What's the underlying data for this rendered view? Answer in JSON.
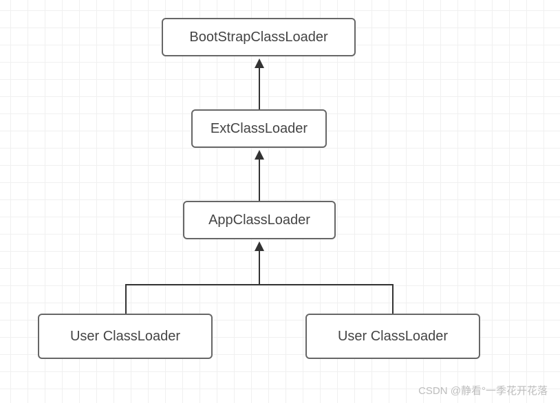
{
  "chart_data": {
    "type": "tree",
    "direction": "bottom-up",
    "nodes": [
      {
        "id": "bootstrap",
        "label": "BootStrapClassLoader"
      },
      {
        "id": "ext",
        "label": "ExtClassLoader"
      },
      {
        "id": "app",
        "label": "AppClassLoader"
      },
      {
        "id": "user1",
        "label": "User ClassLoader"
      },
      {
        "id": "user2",
        "label": "User ClassLoader"
      }
    ],
    "edges": [
      {
        "from": "ext",
        "to": "bootstrap"
      },
      {
        "from": "app",
        "to": "ext"
      },
      {
        "from": "user1",
        "to": "app"
      },
      {
        "from": "user2",
        "to": "app"
      }
    ]
  },
  "watermark": "CSDN @静看°一季花开花落"
}
